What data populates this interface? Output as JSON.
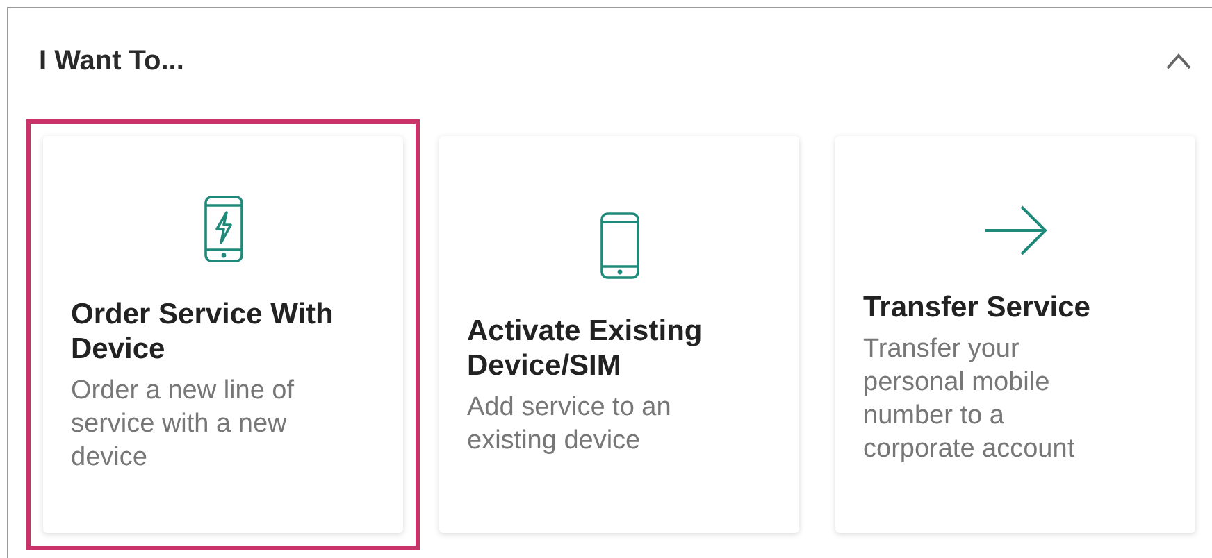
{
  "panel": {
    "title": "I Want To...",
    "expanded": true
  },
  "cards": [
    {
      "kind": "phone-bolt",
      "title": "Order Service With Device",
      "description": "Order a new line of service with a new device",
      "selected": true
    },
    {
      "kind": "phone",
      "title": "Activate Existing Device/SIM",
      "description": "Add service to an existing device",
      "selected": false
    },
    {
      "kind": "arrow",
      "title": "Transfer Service",
      "description": "Transfer your personal mobile number to a corporate account",
      "selected": false
    }
  ]
}
